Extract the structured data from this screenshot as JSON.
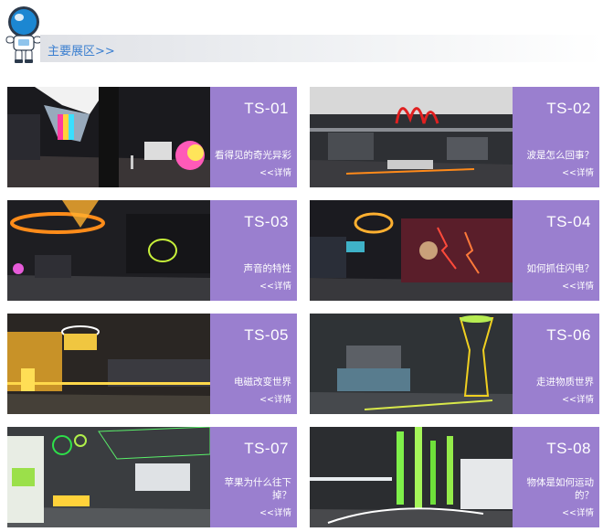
{
  "section": {
    "title": "主要展区>>"
  },
  "more_label": "<<详情",
  "colors": {
    "accent": "#9a7fcf",
    "title_blue": "#3b7fd0"
  },
  "exhibits": [
    {
      "code": "TS-01",
      "name": "看得见的奇光异彩"
    },
    {
      "code": "TS-02",
      "name": "波是怎么回事？"
    },
    {
      "code": "TS-03",
      "name": "声音的特性"
    },
    {
      "code": "TS-04",
      "name": "如何抓住闪电？"
    },
    {
      "code": "TS-05",
      "name": "电磁改变世界"
    },
    {
      "code": "TS-06",
      "name": "走进物质世界"
    },
    {
      "code": "TS-07",
      "name": "苹果为什么往下掉？"
    },
    {
      "code": "TS-08",
      "name": "物体是如何运动的？"
    }
  ]
}
